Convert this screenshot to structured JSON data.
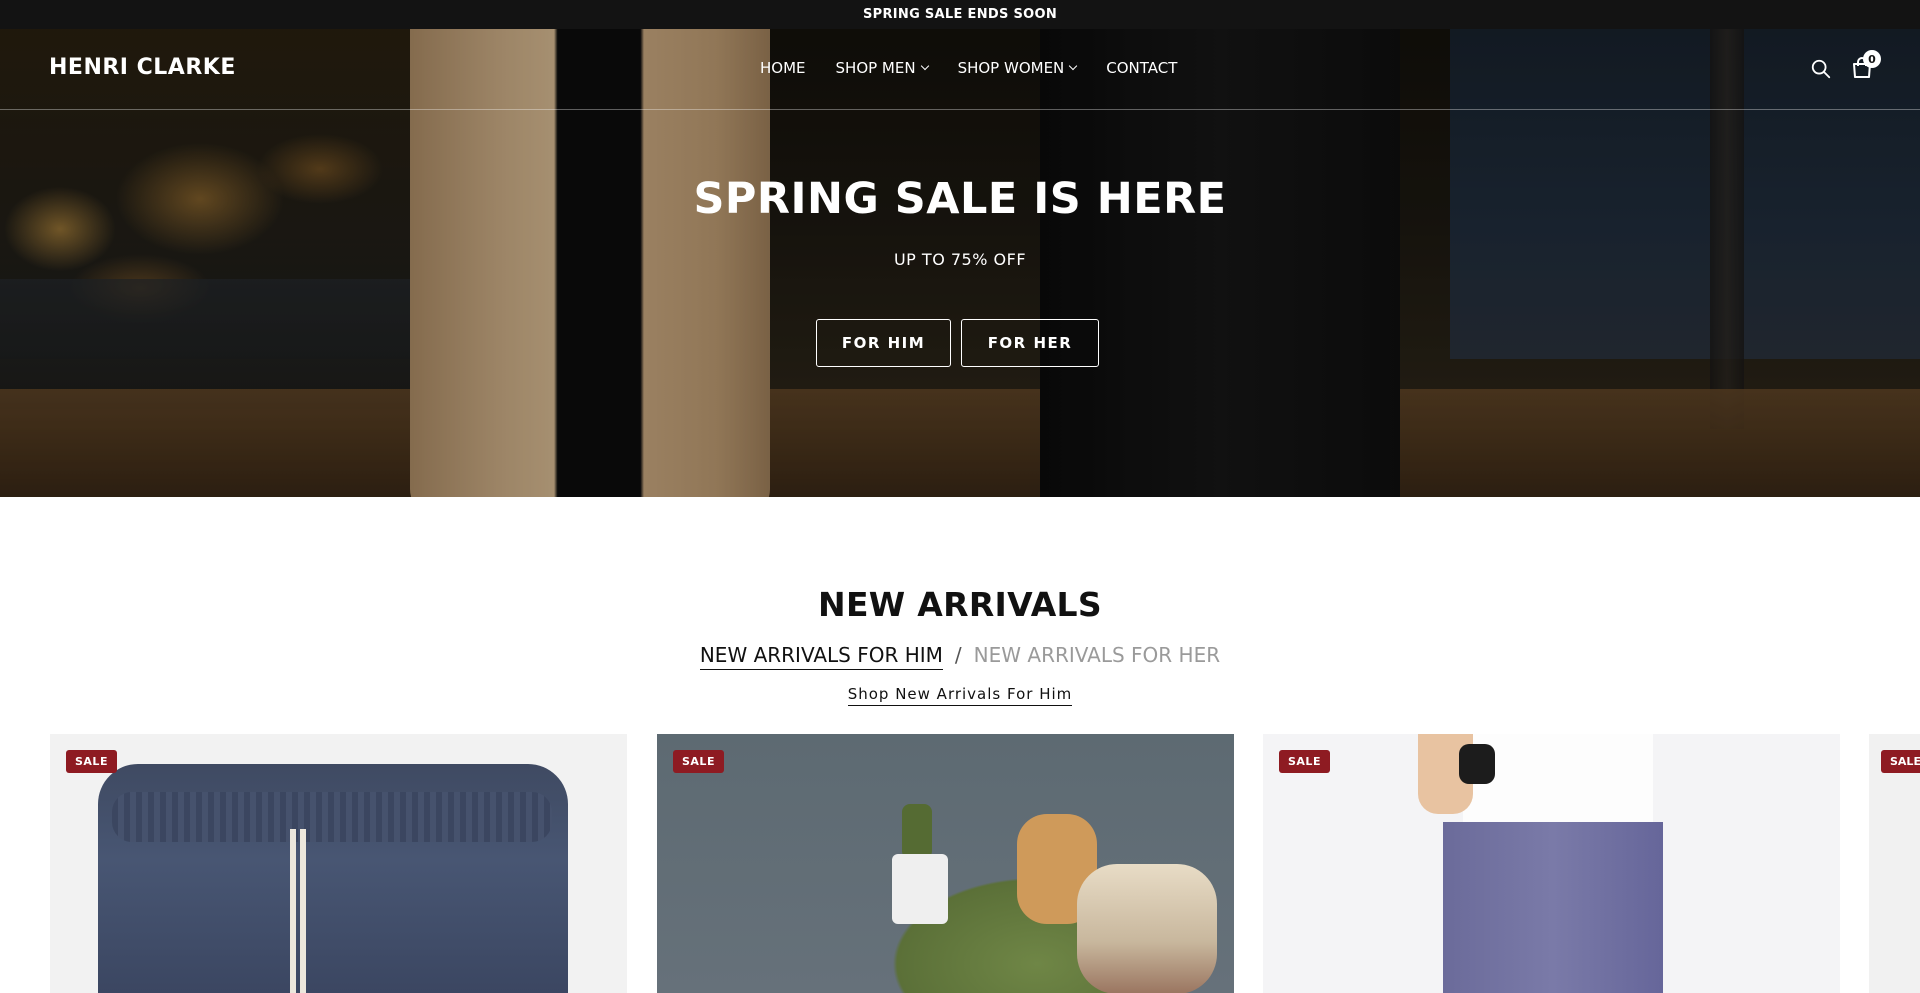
{
  "announcement": "SPRING SALE ENDS SOON",
  "header": {
    "logo": "HENRI CLARKE",
    "nav": [
      {
        "label": "HOME",
        "has_dropdown": false
      },
      {
        "label": "SHOP MEN",
        "has_dropdown": true
      },
      {
        "label": "SHOP WOMEN",
        "has_dropdown": true
      },
      {
        "label": "CONTACT",
        "has_dropdown": false
      }
    ],
    "cart_count": "0",
    "icons": [
      "search-icon",
      "cart-icon"
    ]
  },
  "hero": {
    "title": "SPRING SALE IS HERE",
    "subtitle": "UP TO 75% OFF",
    "buttons": [
      {
        "label": "FOR HIM"
      },
      {
        "label": "FOR HER"
      }
    ]
  },
  "new_arrivals": {
    "title": "NEW ARRIVALS",
    "tab_active": "NEW ARRIVALS FOR HIM",
    "tab_separator": "/",
    "tab_inactive": "NEW ARRIVALS FOR HER",
    "shop_link": "Shop New Arrivals For Him",
    "products": [
      {
        "badge": "SALE"
      },
      {
        "badge": "SALE"
      },
      {
        "badge": "SALE"
      },
      {
        "badge": "SALE"
      }
    ]
  },
  "colors": {
    "announcement_bg": "#131313",
    "sale_badge": "#8e1b22"
  }
}
